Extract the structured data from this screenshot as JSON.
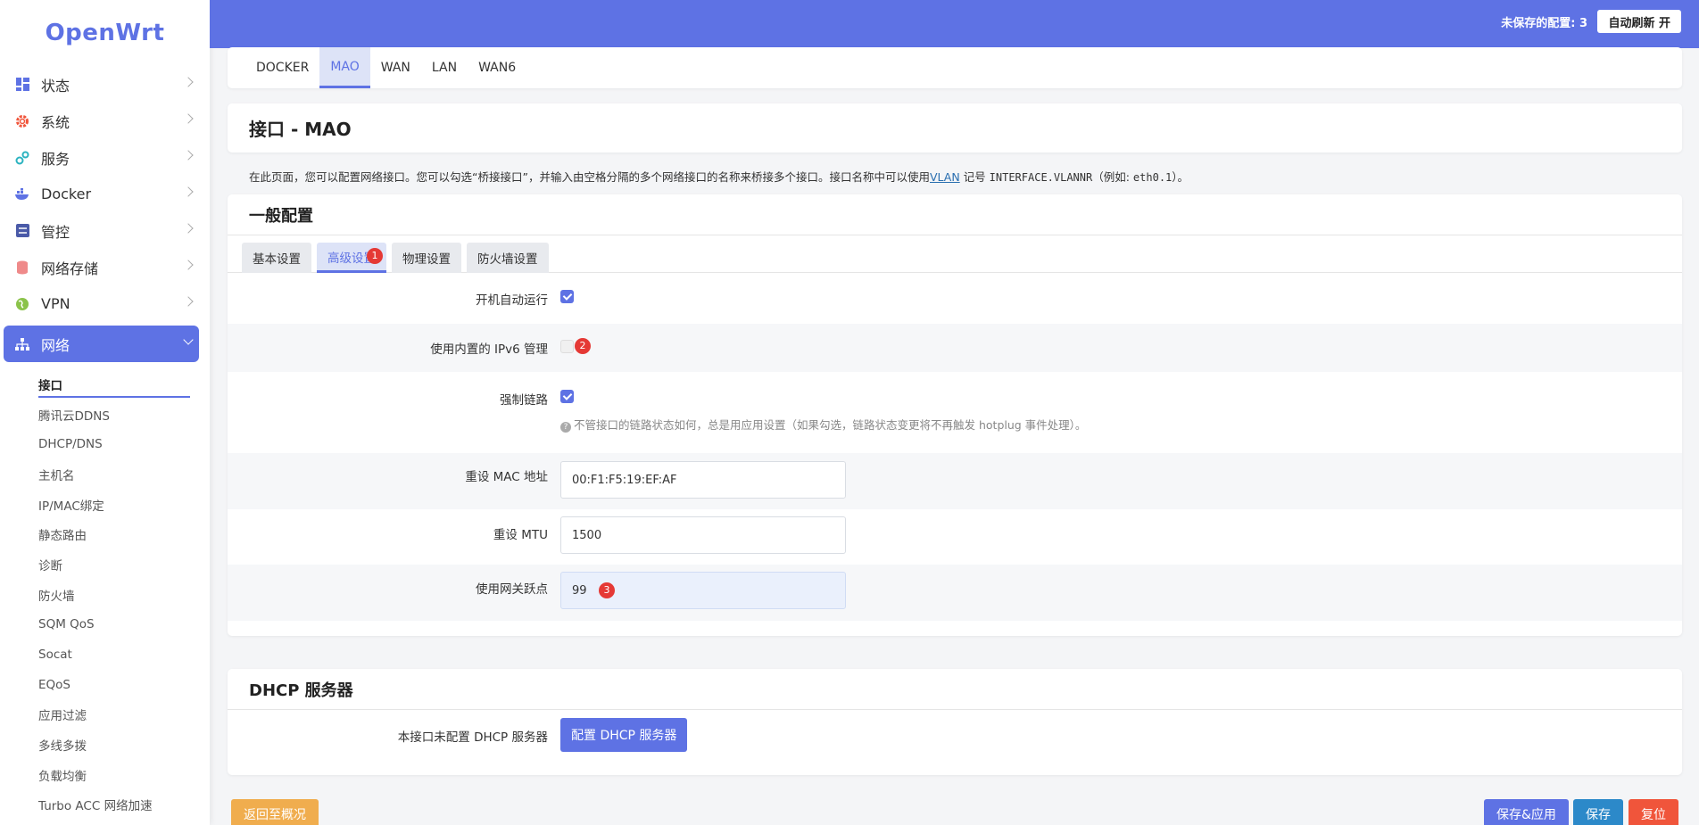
{
  "brand": "OpenWrt",
  "sidebar": {
    "items": [
      {
        "label": "状态",
        "icon": "dashboard-icon"
      },
      {
        "label": "系统",
        "icon": "gear-icon"
      },
      {
        "label": "服务",
        "icon": "gears-icon"
      },
      {
        "label": "Docker",
        "icon": "docker-icon"
      },
      {
        "label": "管控",
        "icon": "sliders-icon"
      },
      {
        "label": "网络存储",
        "icon": "database-icon"
      },
      {
        "label": "VPN",
        "icon": "globe-icon"
      },
      {
        "label": "网络",
        "icon": "network-icon"
      }
    ],
    "subitems": [
      "接口",
      "腾讯云DDNS",
      "DHCP/DNS",
      "主机名",
      "IP/MAC绑定",
      "静态路由",
      "诊断",
      "防火墙",
      "SQM QoS",
      "Socat",
      "EQoS",
      "应用过滤",
      "多线多拨",
      "负载均衡",
      "Turbo ACC 网络加速"
    ]
  },
  "topbar": {
    "unsaved": "未保存的配置: 3",
    "autorefresh": "自动刷新 开"
  },
  "iface_tabs": [
    "DOCKER",
    "MAO",
    "WAN",
    "LAN",
    "WAN6"
  ],
  "page": {
    "title": "接口 - MAO",
    "desc_before": "在此页面，您可以配置网络接口。您可以勾选“桥接接口”，并输入由空格分隔的多个网络接口的名称来桥接多个接口。接口名称中可以使用",
    "desc_link": "VLAN",
    "desc_mid": " 记号 ",
    "desc_code": "INTERFACE.VLANNR",
    "desc_after": "（例如: ",
    "desc_example": "eth0.1",
    "desc_end": "）。"
  },
  "general": {
    "heading": "一般配置",
    "tabs": [
      "基本设置",
      "高级设置",
      "物理设置",
      "防火墙设置"
    ],
    "fields": {
      "autostart_label": "开机自动运行",
      "ipv6_label": "使用内置的 IPv6 管理",
      "force_link_label": "强制链路",
      "force_link_help": "不管接口的链路状态如何，总是用应用设置（如果勾选，链路状态变更将不再触发 hotplug 事件处理）。",
      "mac_label": "重设 MAC 地址",
      "mac_value": "00:F1:F5:19:EF:AF",
      "mtu_label": "重设 MTU",
      "mtu_value": "1500",
      "metric_label": "使用网关跃点",
      "metric_value": "99"
    },
    "badges": [
      "1",
      "2",
      "3"
    ]
  },
  "dhcp": {
    "heading": "DHCP 服务器",
    "label": "本接口未配置 DHCP 服务器",
    "button": "配置 DHCP 服务器"
  },
  "footer": {
    "back": "返回至概况",
    "save_apply": "保存&应用",
    "save": "保存",
    "reset": "复位"
  },
  "colors": {
    "accent": "#5e72e4",
    "back": "#f0ad4e",
    "save": "#2c89c9",
    "reset": "#f0553b",
    "badge": "#e53935"
  }
}
